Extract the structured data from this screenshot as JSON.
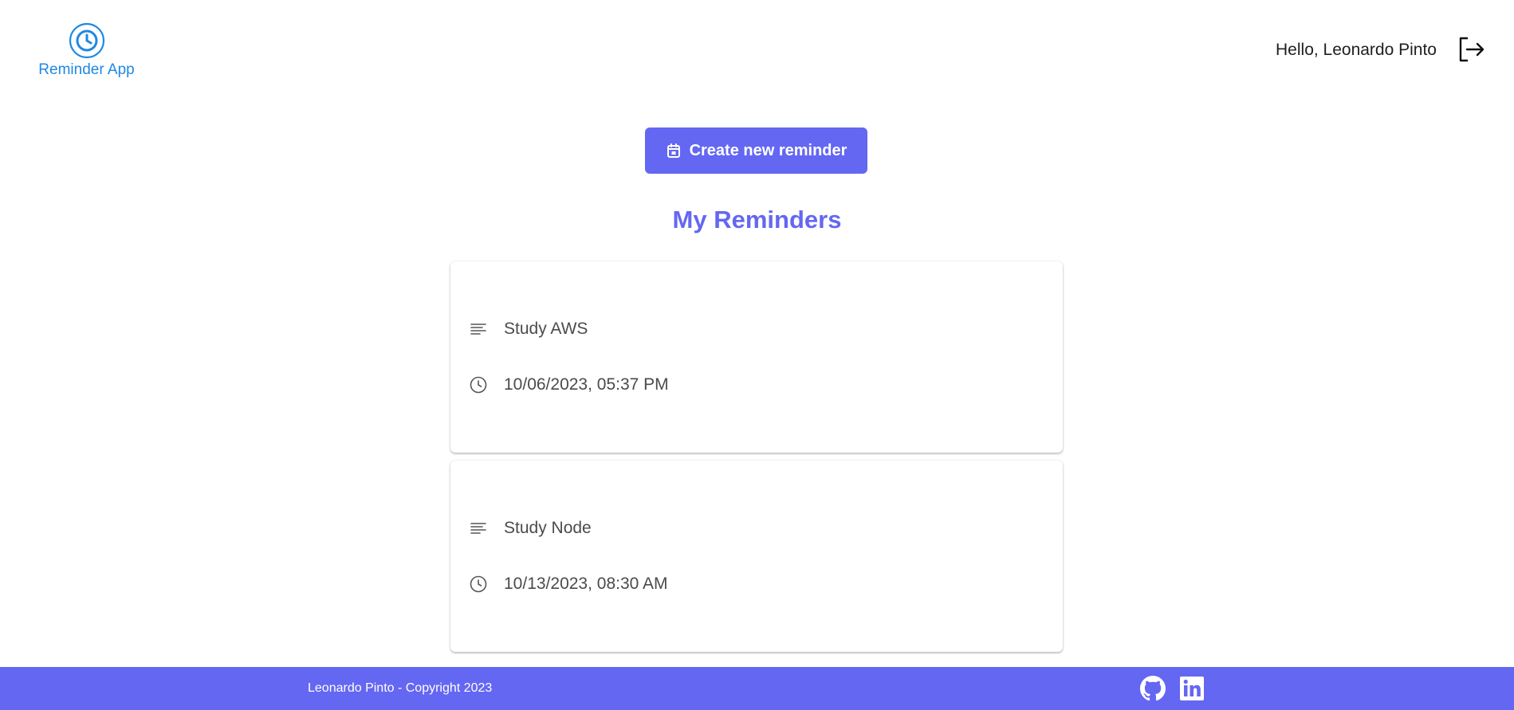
{
  "header": {
    "app_name": "Reminder App",
    "greeting": "Hello, Leonardo Pinto",
    "logo_icon": "clock-icon",
    "logout_icon": "logout-icon"
  },
  "actions": {
    "create_label": "Create new reminder",
    "create_icon": "calendar-icon"
  },
  "main": {
    "title": "My Reminders",
    "reminders": [
      {
        "description": "Study AWS",
        "datetime": "10/06/2023, 05:37 PM"
      },
      {
        "description": "Study Node",
        "datetime": "10/13/2023, 08:30 AM"
      }
    ]
  },
  "footer": {
    "copyright": "Leonardo Pinto - Copyright 2023",
    "icons": [
      "github-icon",
      "linkedin-icon"
    ]
  },
  "colors": {
    "accent": "#6467f2",
    "logo_blue": "#1e88e5"
  }
}
